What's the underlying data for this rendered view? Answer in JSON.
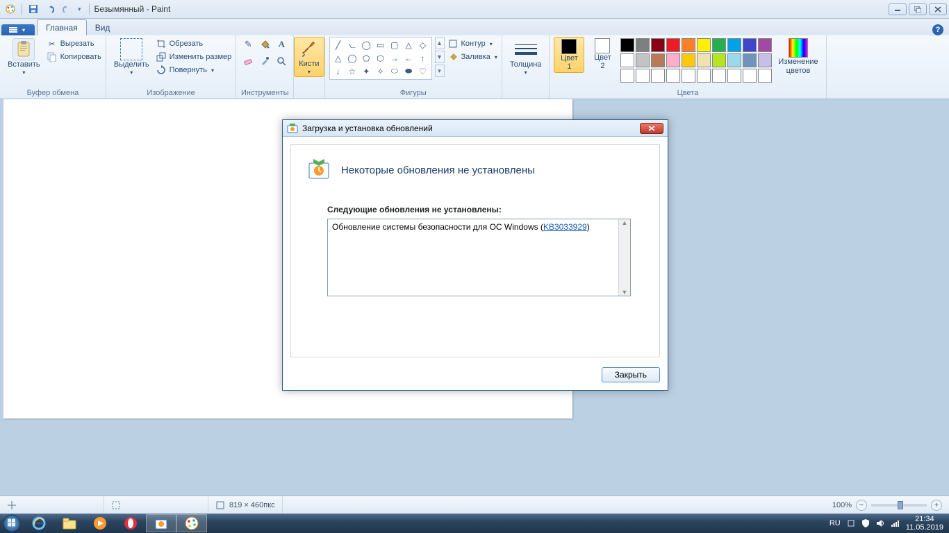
{
  "titlebar": {
    "title": "Безымянный - Paint"
  },
  "tabs": {
    "home": "Главная",
    "view": "Вид"
  },
  "ribbon": {
    "paste": "Вставить",
    "cut": "Вырезать",
    "copy": "Копировать",
    "clipboard_group": "Буфер обмена",
    "select": "Выделить",
    "crop": "Обрезать",
    "resize": "Изменить размер",
    "rotate": "Повернуть",
    "image_group": "Изображение",
    "tools_group": "Инструменты",
    "brushes": "Кисти",
    "outline": "Контур",
    "fill": "Заливка",
    "shapes_group": "Фигуры",
    "thickness": "Толщина",
    "color1": "Цвет\n1",
    "color2": "Цвет\n2",
    "edit_colors": "Изменение\nцветов",
    "colors_group": "Цвета"
  },
  "palette_top": [
    "#000000",
    "#7f7f7f",
    "#880015",
    "#ed1c24",
    "#ff7f27",
    "#fff200",
    "#22b14c",
    "#00a2e8",
    "#3f48cc",
    "#a349a4"
  ],
  "palette_bot": [
    "#ffffff",
    "#c3c3c3",
    "#b97a57",
    "#ffaec9",
    "#ffc90e",
    "#efe4b0",
    "#b5e61d",
    "#99d9ea",
    "#7092be",
    "#c8bfe7"
  ],
  "palette_empty_count": 10,
  "statusbar": {
    "dims": "819 × 460пкс",
    "zoom": "100%"
  },
  "dialog": {
    "title": "Загрузка и установка обновлений",
    "heading": "Некоторые обновления не установлены",
    "subhead": "Следующие обновления не установлены:",
    "item_pre": "Обновление системы безопасности для ОС Windows (",
    "item_kb": "KB3033929",
    "item_post": ")",
    "close": "Закрыть"
  },
  "tray": {
    "lang": "RU",
    "time": "21:34",
    "date": "11.05.2019"
  }
}
